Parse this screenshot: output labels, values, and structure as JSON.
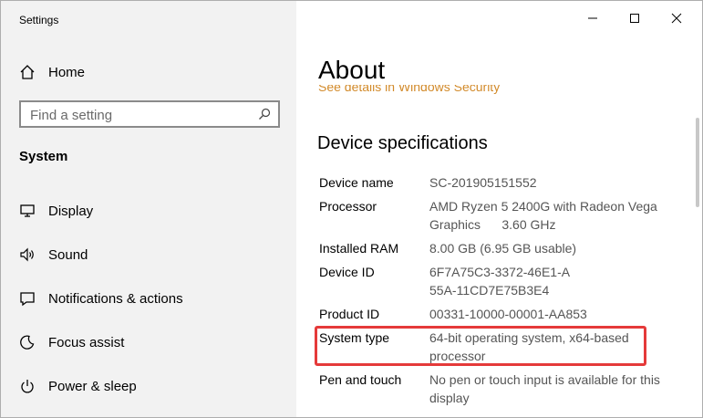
{
  "window": {
    "app_title": "Settings",
    "controls": {
      "minimize": "minimize",
      "maximize": "maximize",
      "close": "close"
    }
  },
  "sidebar": {
    "home_label": "Home",
    "search": {
      "placeholder": "Find a setting"
    },
    "section_label": "System",
    "items": [
      {
        "label": "Display",
        "icon": "display-icon"
      },
      {
        "label": "Sound",
        "icon": "sound-icon"
      },
      {
        "label": "Notifications & actions",
        "icon": "notifications-icon"
      },
      {
        "label": "Focus assist",
        "icon": "focus-assist-icon"
      },
      {
        "label": "Power & sleep",
        "icon": "power-icon"
      }
    ]
  },
  "main": {
    "title": "About",
    "link_peek": "See details in Windows Security",
    "subheading": "Device specifications",
    "specs": [
      {
        "key": "Device name",
        "value": "SC-201905151552"
      },
      {
        "key": "Processor",
        "value": "AMD Ryzen 5 2400G with Radeon Vega Graphics      3.60 GHz"
      },
      {
        "key": "Installed RAM",
        "value": "8.00 GB (6.95 GB usable)"
      },
      {
        "key": "Device ID",
        "value": "6F7A75C3-3372-46E1-A55A-11CD7E75B3E4"
      },
      {
        "key": "Product ID",
        "value": "00331-10000-00001-AA853"
      },
      {
        "key": "System type",
        "value": "64-bit operating system, x64-based processor"
      },
      {
        "key": "Pen and touch",
        "value": "No pen or touch input is available for this display"
      }
    ]
  },
  "colors": {
    "sidebar_bg": "#f2f2f2",
    "highlight_border": "#e53a3a",
    "link_color": "#d28a2a"
  }
}
